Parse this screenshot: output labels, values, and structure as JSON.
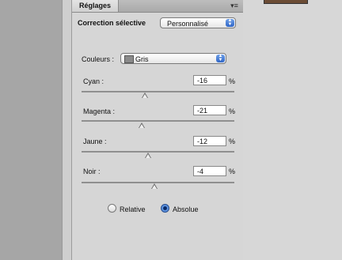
{
  "panel": {
    "tab_label": "Réglages",
    "menu_icon": "panel-menu-icon",
    "title": "Correction sélective",
    "preset": {
      "value": "Personnalisé",
      "options": [
        "Personnalisé"
      ]
    },
    "colors": {
      "label": "Couleurs :",
      "value": "Gris"
    },
    "adjustments": [
      {
        "label": "Cyan :",
        "value": "-16",
        "unit": "%",
        "slider_percent": -16
      },
      {
        "label": "Magenta :",
        "value": "-21",
        "unit": "%",
        "slider_percent": -21
      },
      {
        "label": "Jaune :",
        "value": "-12",
        "unit": "%",
        "slider_percent": -12
      },
      {
        "label": "Noir :",
        "value": "-4",
        "unit": "%",
        "slider_percent": -4
      }
    ],
    "method": {
      "relative_label": "Relative",
      "absolute_label": "Absolue",
      "selected": "Absolue"
    }
  },
  "colors": {
    "accent": "#2f66c7",
    "panel_bg": "#d6d6d6",
    "canvas_bg": "#a6a6a6"
  }
}
